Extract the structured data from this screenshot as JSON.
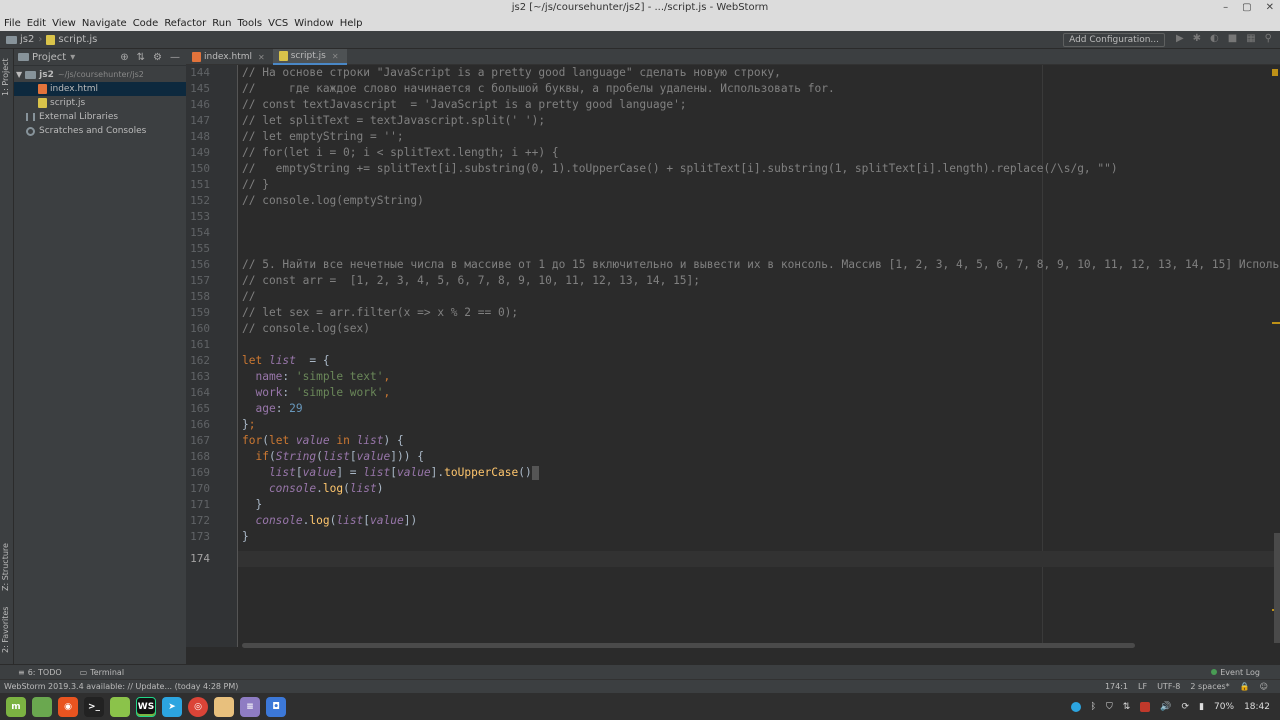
{
  "window": {
    "title": "js2 [~/js/coursehunter/js2] - .../script.js - WebStorm"
  },
  "menu": [
    "File",
    "Edit",
    "View",
    "Navigate",
    "Code",
    "Refactor",
    "Run",
    "Tools",
    "VCS",
    "Window",
    "Help"
  ],
  "breadcrumb": {
    "project": "js2",
    "file": "script.js"
  },
  "toolbar": {
    "add_config": "Add Configuration..."
  },
  "sidebar": {
    "strip_project": "1: Project",
    "strip_structure": "Z: Structure",
    "strip_favorites": "2: Favorites",
    "panel_title": "Project",
    "root_name": "js2",
    "root_path": "~/js/coursehunter/js2",
    "files": [
      "index.html",
      "script.js"
    ],
    "external": "External Libraries",
    "scratches": "Scratches and Consoles"
  },
  "editor": {
    "tabs": [
      "index.html",
      "script.js"
    ],
    "line_numbers": [
      "144",
      "145",
      "146",
      "147",
      "148",
      "149",
      "150",
      "151",
      "152",
      "153",
      "154",
      "155",
      "156",
      "157",
      "158",
      "159",
      "160",
      "161",
      "162",
      "163",
      "164",
      "165",
      "166",
      "167",
      "168",
      "169",
      "170",
      "171",
      "172",
      "173",
      "174"
    ],
    "code": {
      "l144": "// На основе строки \"JavaScript is a pretty good language\" сделать новую строку,",
      "l145": "//     где каждое слово начинается с большой буквы, а пробелы удалены. Использовать for.",
      "l146": "// const textJavascript  = 'JavaScript is a pretty good language';",
      "l147": "// let splitText = textJavascript.split(' ');",
      "l148": "// let emptyString = '';",
      "l149": "// for(let i = 0; i < splitText.length; i ++) {",
      "l150": "//   emptyString += splitText[i].substring(0, 1).toUpperCase() + splitText[i].substring(1, splitText[i].length).replace(/\\s/g, \"\")",
      "l151": "// }",
      "l152": "// console.log(emptyString)",
      "l156": "// 5. Найти все нечетные числа в массиве от 1 до 15 включительно и вывести их в консоль. Массив [1, 2, 3, 4, 5, 6, 7, 8, 9, 10, 11, 12, 13, 14, 15] Использо",
      "l157": "// const arr =  [1, 2, 3, 4, 5, 6, 7, 8, 9, 10, 11, 12, 13, 14, 15];",
      "l158": "//",
      "l159": "// let sex = arr.filter(x => x % 2 == 0);",
      "l160": "// console.log(sex)"
    }
  },
  "bottom": {
    "todo": "6: TODO",
    "terminal": "Terminal",
    "event_log": "Event Log"
  },
  "status": {
    "message": "WebStorm 2019.3.4 available: // Update... (today 4:28 PM)",
    "position": "174:1",
    "line_sep": "LF",
    "encoding": "UTF-8",
    "indent": "2 spaces*"
  },
  "taskbar": {
    "battery": "70%",
    "time": "18:42"
  },
  "colors": {
    "editor_bg": "#2b2b2b",
    "panel_bg": "#3c3f41",
    "accent": "#4a88c7",
    "keyword": "#cc7832",
    "string": "#6a8759",
    "number": "#6897bb",
    "comment": "#808080"
  }
}
